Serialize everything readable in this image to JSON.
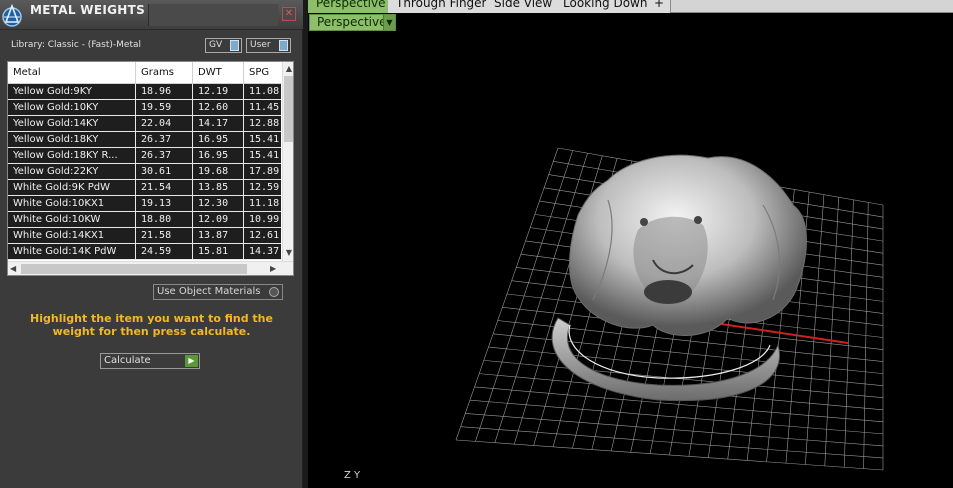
{
  "panel": {
    "title": "METAL WEIGHTS",
    "close_glyph": "✕",
    "library_label": "Library: Classic - (Fast)-Metal",
    "gv_label": "GV",
    "user_label": "User",
    "columns": [
      "Metal",
      "Grams",
      "DWT",
      "SPG"
    ],
    "rows": [
      [
        "Yellow Gold:9KY",
        "18.96",
        "12.19",
        "11.08"
      ],
      [
        "Yellow Gold:10KY",
        "19.59",
        "12.60",
        "11.45"
      ],
      [
        "Yellow Gold:14KY",
        "22.04",
        "14.17",
        "12.88"
      ],
      [
        "Yellow Gold:18KY",
        "26.37",
        "16.95",
        "15.41"
      ],
      [
        "Yellow Gold:18KY R...",
        "26.37",
        "16.95",
        "15.41"
      ],
      [
        "Yellow Gold:22KY",
        "30.61",
        "19.68",
        "17.89"
      ],
      [
        "White Gold:9K PdW",
        "21.54",
        "13.85",
        "12.59"
      ],
      [
        "White Gold:10KX1",
        "19.13",
        "12.30",
        "11.18"
      ],
      [
        "White Gold:10KW",
        "18.80",
        "12.09",
        "10.99"
      ],
      [
        "White Gold:14KX1",
        "21.58",
        "13.87",
        "12.61"
      ],
      [
        "White Gold:14K PdW",
        "24.59",
        "15.81",
        "14.37"
      ]
    ],
    "use_object_materials_label": "Use Object Materials",
    "instruction": "Highlight the item you want to find the weight for then press calculate.",
    "calculate_label": "Calculate"
  },
  "viewport": {
    "tabs": [
      "Perspective",
      "Through Finger",
      "Side View",
      "Looking Down"
    ],
    "add_tab_glyph": "+",
    "active_view": "Perspective",
    "axis_label": "Z Y",
    "accent_color": "#8dbf6a",
    "instruction_color": "#f2b826"
  }
}
